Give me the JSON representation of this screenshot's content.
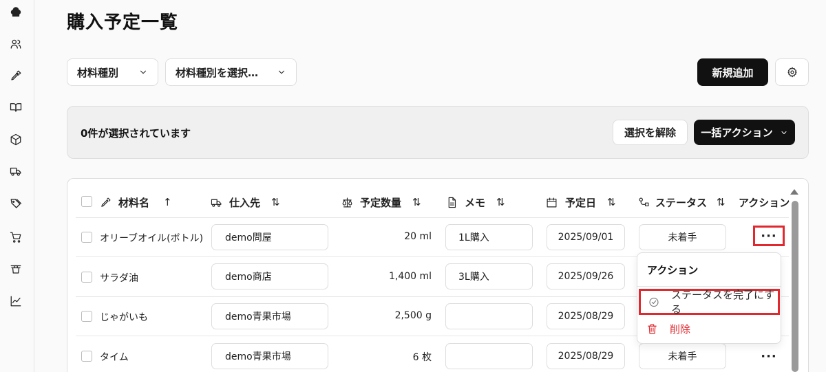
{
  "sidebar": {
    "items": [
      {
        "icon": "chef-hat-icon"
      },
      {
        "icon": "users-icon"
      },
      {
        "icon": "pen-icon"
      },
      {
        "icon": "book-icon"
      },
      {
        "icon": "package-icon"
      },
      {
        "icon": "truck-icon"
      },
      {
        "icon": "tags-icon"
      },
      {
        "icon": "cart-icon"
      },
      {
        "icon": "trash-basket-icon"
      },
      {
        "icon": "chart-line-icon"
      }
    ]
  },
  "header": {
    "title": "購入予定一覧"
  },
  "filters": {
    "material_type": "材料種別",
    "material_type_select": "材料種別を選択…"
  },
  "toolbar": {
    "add_label": "新規追加"
  },
  "selection": {
    "count_text": "0件が選択されています",
    "clear_label": "選択を解除",
    "bulk_label": "一括アクション"
  },
  "table": {
    "columns": {
      "name": "材料名",
      "supplier": "仕入先",
      "quantity": "予定数量",
      "memo": "メモ",
      "date": "予定日",
      "status": "ステータス",
      "action": "アクション"
    },
    "sort_asc": "↑",
    "sort_both": "⇅",
    "rows": [
      {
        "name": "オリーブオイル(ボトル)",
        "supplier": "demo問屋",
        "quantity": "20 ml",
        "memo": "1L購入",
        "date": "2025/09/01",
        "status": "未着手",
        "more": "···"
      },
      {
        "name": "サラダ油",
        "supplier": "demo商店",
        "quantity": "1,400 ml",
        "memo": "3L購入",
        "date": "2025/09/26",
        "status": "",
        "more": ""
      },
      {
        "name": "じゃがいも",
        "supplier": "demo青果市場",
        "quantity": "2,500 g",
        "memo": "",
        "date": "2025/08/29",
        "status": "",
        "more": ""
      },
      {
        "name": "タイム",
        "supplier": "demo青果市場",
        "quantity": "6 枚",
        "memo": "",
        "date": "2025/08/29",
        "status": "未着手",
        "more": "···"
      }
    ]
  },
  "action_menu": {
    "title": "アクション",
    "complete_label": "ステータスを完了にする",
    "delete_label": "削除"
  },
  "colors": {
    "accent_dark": "#111111",
    "danger": "#e0282e",
    "highlight": "#e0282e"
  }
}
